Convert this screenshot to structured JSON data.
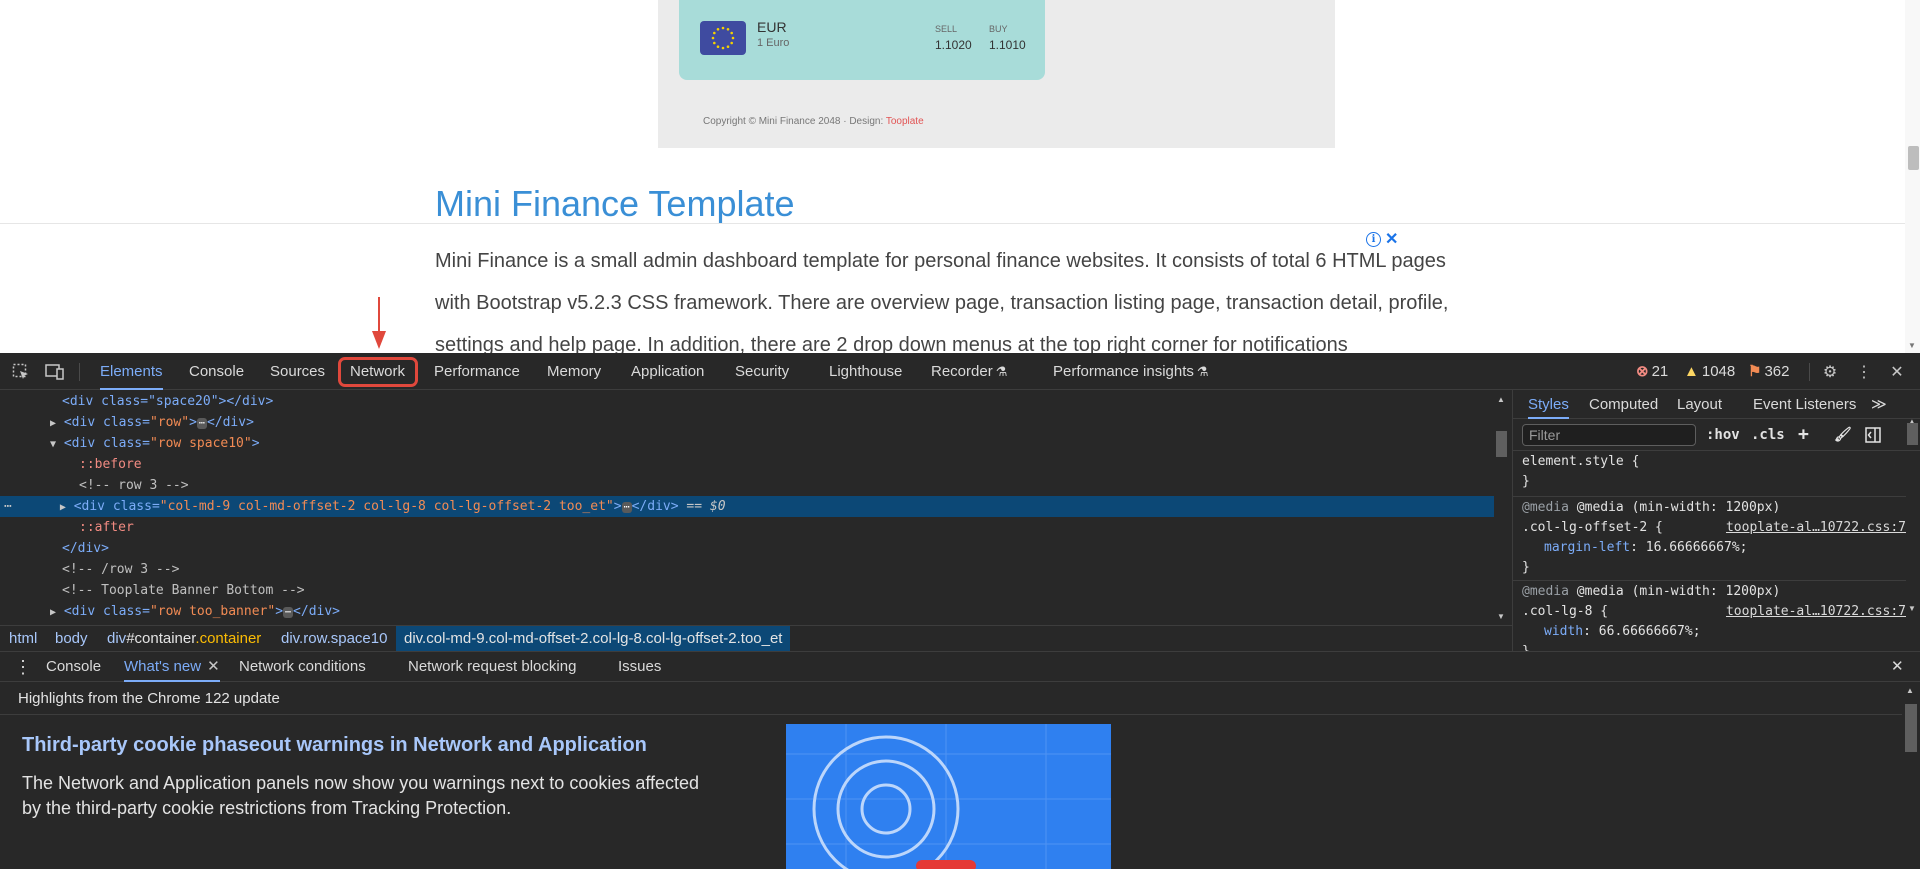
{
  "page": {
    "preview": {
      "currency_code": "EUR",
      "currency_name": "1 Euro",
      "sell_label": "SELL",
      "buy_label": "BUY",
      "sell_value": "1.1020",
      "buy_value": "1.1010",
      "copyright_prefix": "Copyright © Mini Finance 2048 · Design: ",
      "copyright_link": "Tooplate"
    },
    "title": "Mini Finance Template",
    "description": "Mini Finance is a small admin dashboard template for personal finance websites. It consists of total 6 HTML pages with Bootstrap v5.2.3 CSS framework. There are overview page, transaction listing page, transaction detail, profile, settings and help page. In addition, there are 2 drop down menus at the top right corner for notifications",
    "ad_info_glyph": "i",
    "ad_close_glyph": "✕"
  },
  "devtools": {
    "tabs": [
      {
        "label": "Elements"
      },
      {
        "label": "Console"
      },
      {
        "label": "Sources"
      },
      {
        "label": "Network"
      },
      {
        "label": "Performance"
      },
      {
        "label": "Memory"
      },
      {
        "label": "Application"
      },
      {
        "label": "Security"
      },
      {
        "label": "Lighthouse"
      },
      {
        "label": "Recorder"
      },
      {
        "label": "Performance insights"
      }
    ],
    "active_tab": "Elements",
    "highlighted_tab": "Network",
    "errors_count": "21",
    "warnings_count": "1048",
    "issues_count": "362",
    "dom_lines": {
      "l0": "<div class=\"space20\"></div>",
      "l1_tag": "<div class=",
      "l1_val": "\"row\"",
      "l2_tag": "<div class=",
      "l2_val": "\"row space10\"",
      "l3": "::before",
      "l4": "<!-- row 3 -->",
      "l5_tag": "<div class=",
      "l5_val": "\"col-md-9 col-md-offset-2 col-lg-8 col-lg-offset-2 too_et\"",
      "l5_suffix": "== $0",
      "l6": "::after",
      "l7": "</div>",
      "l8": "<!-- /row 3 -->",
      "l9": "<!-- Tooplate Banner Bottom -->",
      "l10_tag": "<div class=",
      "l10_val": "\"row too_banner\""
    },
    "breadcrumbs": {
      "html": "html",
      "body": "body",
      "container_tag": "div",
      "container_id": "#container",
      "container_cls": ".container",
      "row": "div.row.space10",
      "selected": "div.col-md-9.col-md-offset-2.col-lg-8.col-lg-offset-2.too_et"
    },
    "styles": {
      "tabs": [
        "Styles",
        "Computed",
        "Layout",
        "Event Listeners"
      ],
      "more": "≫",
      "filter_placeholder": "Filter",
      "hov": ":hov",
      "cls": ".cls",
      "element_style": "element.style {",
      "close_brace": "}",
      "media1": "@media (min-width: 1200px)",
      "rule1_selector": ".col-lg-offset-2 {",
      "rule1_source": "tooplate-al…10722.css:7",
      "rule1_prop": "margin-left",
      "rule1_value": ": 16.66666667%;",
      "media2": "@media (min-width: 1200px)",
      "rule2_selector": ".col-lg-8 {",
      "rule2_source": "tooplate-al…10722.css:7",
      "rule2_prop": "width",
      "rule2_value": ": 66.66666667%;"
    },
    "drawer": {
      "tabs": [
        "Console",
        "What's new",
        "Network conditions",
        "Network request blocking",
        "Issues"
      ],
      "active": "What's new",
      "highlights": "Highlights from the Chrome 122 update",
      "article_title": "Third-party cookie phaseout warnings in Network and Application",
      "article_body": "The Network and Application panels now show you warnings next to cookies affected by the third-party cookie restrictions from Tracking Protection."
    }
  },
  "colors": {
    "accent": "#7cacf8",
    "annotation": "#e0483c",
    "title_blue": "#3a8fd6",
    "card": "#a8dcd9"
  }
}
